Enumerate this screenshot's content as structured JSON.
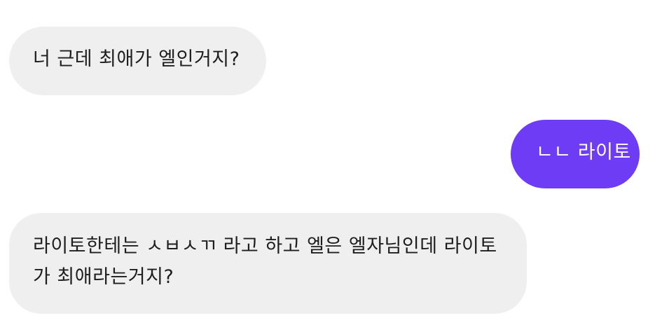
{
  "conversation": {
    "messages": [
      {
        "side": "incoming",
        "text": "너 근데 최애가 엘인거지?"
      },
      {
        "side": "outgoing",
        "text": "ㄴㄴ 라이토"
      },
      {
        "side": "incoming",
        "text": "라이토한테는 ㅅㅂㅅㄲ 라고 하고 엘은 엘자님인데 라이토가 최애라는거지?"
      }
    ]
  },
  "colors": {
    "incoming_bubble": "#efefef",
    "outgoing_bubble": "#6f3cf5",
    "background": "#ffffff"
  }
}
